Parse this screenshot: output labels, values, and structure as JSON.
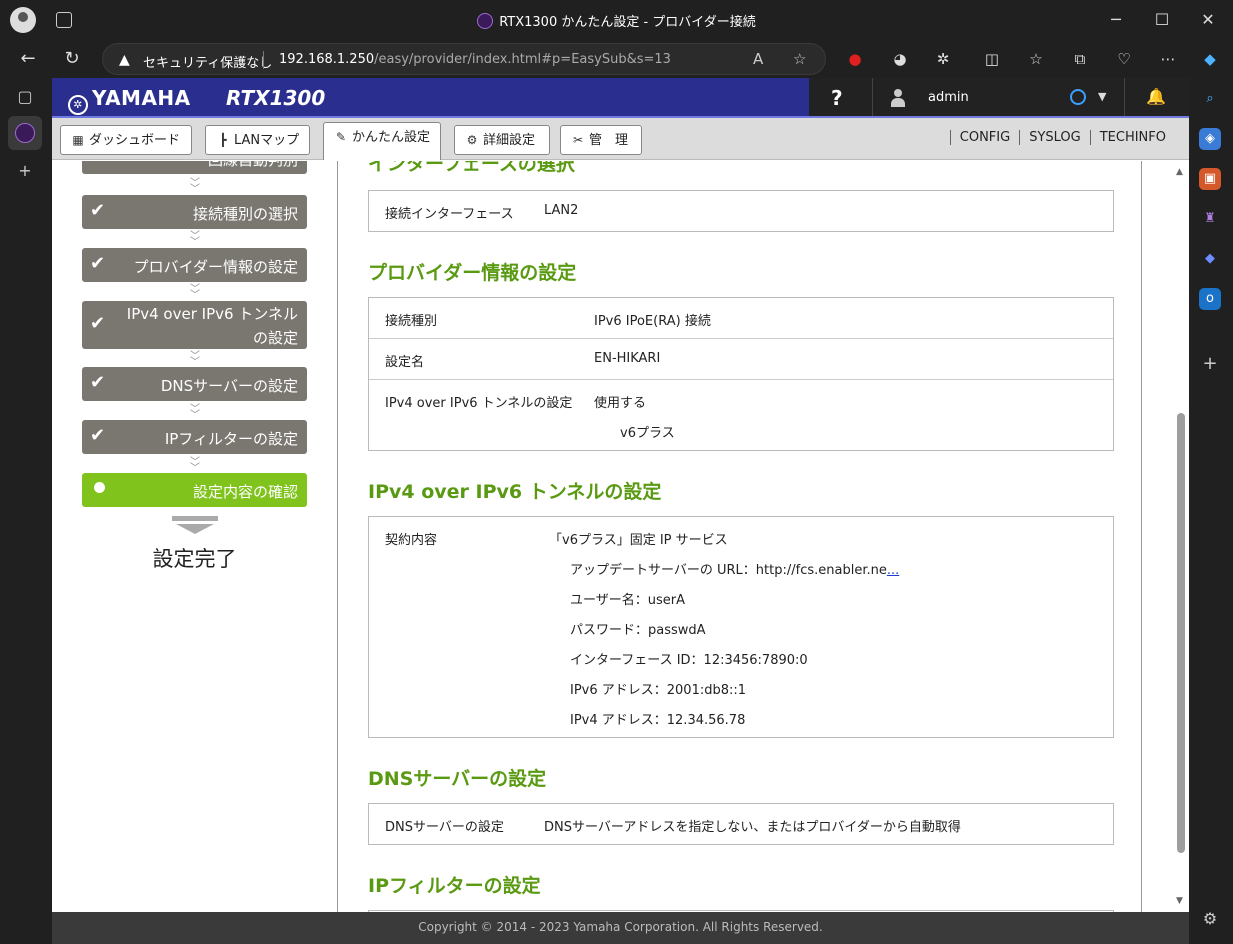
{
  "browser": {
    "window_title": "RTX1300 かんたん設定 - プロバイダー接続",
    "security_label": "セキュリティ保護なし",
    "url_host": "192.168.1.250",
    "url_path": "/easy/provider/index.html#p=EasySub&s=13"
  },
  "header": {
    "brand": "YAMAHA",
    "model": "RTX1300",
    "help": "?",
    "user": "admin"
  },
  "menu": {
    "dashboard": "ダッシュボード",
    "lanmap": "LANマップ",
    "easy": "かんたん設定",
    "detail": "詳細設定",
    "admin": "管　理",
    "links": [
      "CONFIG",
      "SYSLOG",
      "TECHINFO"
    ]
  },
  "sidebar": {
    "steps": [
      "回線自動判別",
      "接続種別の選択",
      "プロバイダー情報の設定",
      "IPv4 over IPv6 トンネル",
      "の設定",
      "DNSサーバーの設定",
      "IPフィルターの設定",
      "設定内容の確認"
    ],
    "finish": "設定完了"
  },
  "content": {
    "s1_title": "インターフェースの選択",
    "s1_key": "接続インターフェース",
    "s1_val": "LAN2",
    "s2_title": "プロバイダー情報の設定",
    "s2_rows": [
      {
        "k": "接続種別",
        "v": "IPv6 IPoE(RA) 接続"
      },
      {
        "k": "設定名",
        "v": "EN-HIKARI"
      },
      {
        "k": "IPv4 over IPv6 トンネルの設定",
        "v": "使用する"
      }
    ],
    "s2_sub": "v6プラス",
    "s3_title": "IPv4 over IPv6 トンネルの設定",
    "s3_key": "契約内容",
    "s3_val": "「v6プラス」固定 IP サービス",
    "s3_sub": [
      "アップデートサーバーの URL：http://fcs.enabler.ne",
      "ユーザー名：userA",
      "パスワード：passwdA",
      "インターフェース ID：12:3456:7890:0",
      "IPv6 アドレス：2001:db8::1",
      "IPv4 アドレス：12.34.56.78"
    ],
    "s3_ellipsis": "...",
    "s4_title": "DNSサーバーの設定",
    "s4_key": "DNSサーバーの設定",
    "s4_val": "DNSサーバーアドレスを指定しない、またはプロバイダーから自動取得",
    "s5_title": "IPフィルターの設定"
  },
  "footer": "Copyright © 2014 - 2023 Yamaha Corporation. All Rights Reserved.",
  "colors": {
    "header_blue": "#2a2f8f",
    "section_green": "#5a9a12",
    "step_gray": "#7a7670",
    "step_current": "#7fc31c"
  }
}
